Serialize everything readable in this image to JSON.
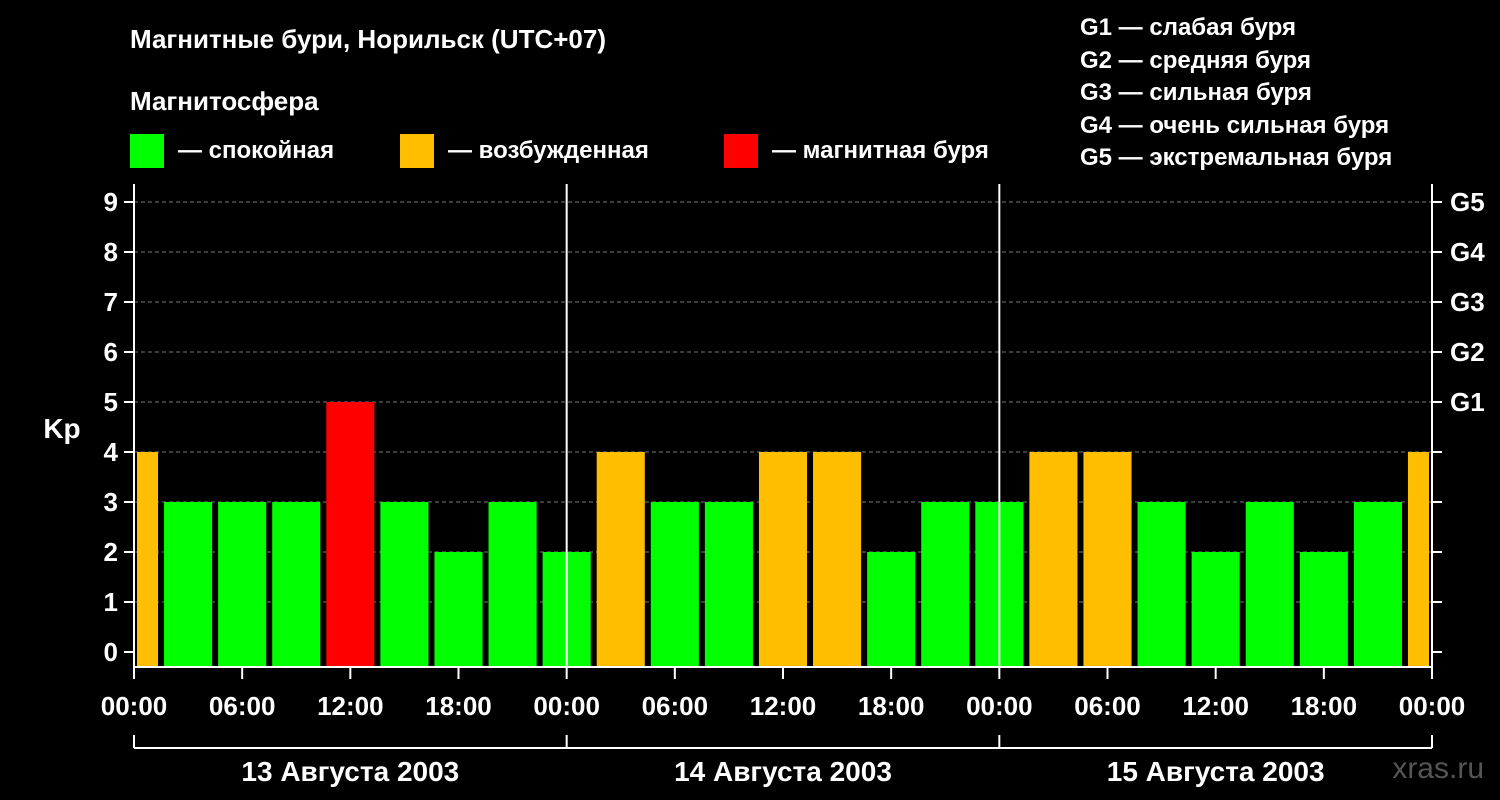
{
  "chart_data": {
    "type": "bar",
    "title": "Магнитные бури, Норильск (UTC+07)",
    "subtitle": "Магнитосфера",
    "ylabel": "Kp",
    "ylim": [
      0,
      9
    ],
    "yticks": [
      "0",
      "1",
      "2",
      "3",
      "4",
      "5",
      "6",
      "7",
      "8",
      "9"
    ],
    "right_ticks": [
      {
        "value": 5,
        "label": "G1"
      },
      {
        "value": 6,
        "label": "G2"
      },
      {
        "value": 7,
        "label": "G3"
      },
      {
        "value": 8,
        "label": "G4"
      },
      {
        "value": 9,
        "label": "G5"
      }
    ],
    "x_range_hours": [
      0,
      72
    ],
    "xtick_labels": [
      "00:00",
      "06:00",
      "12:00",
      "18:00",
      "00:00",
      "06:00",
      "12:00",
      "18:00",
      "00:00",
      "06:00",
      "12:00",
      "18:00",
      "00:00"
    ],
    "day_labels": [
      "13 Августа 2003",
      "14 Августа 2003",
      "15 Августа 2003"
    ],
    "status_colors": {
      "calm": "#00ff00",
      "excited": "#ffbf00",
      "storm": "#ff0000"
    },
    "legend": [
      {
        "status": "calm",
        "label": "— спокойная"
      },
      {
        "status": "excited",
        "label": "— возбужденная"
      },
      {
        "status": "storm",
        "label": "— магнитная буря"
      }
    ],
    "storm_scale": [
      "G1 — слабая буря",
      "G2 — средняя буря",
      "G3 — сильная буря",
      "G4 — очень сильная буря",
      "G5 — экстремальная буря"
    ],
    "bars": [
      {
        "start": -1.5,
        "end": 1.5,
        "kp": 4,
        "status": "excited"
      },
      {
        "start": 1.5,
        "end": 4.5,
        "kp": 3,
        "status": "calm"
      },
      {
        "start": 4.5,
        "end": 7.5,
        "kp": 3,
        "status": "calm"
      },
      {
        "start": 7.5,
        "end": 10.5,
        "kp": 3,
        "status": "calm"
      },
      {
        "start": 10.5,
        "end": 13.5,
        "kp": 5,
        "status": "storm"
      },
      {
        "start": 13.5,
        "end": 16.5,
        "kp": 3,
        "status": "calm"
      },
      {
        "start": 16.5,
        "end": 19.5,
        "kp": 2,
        "status": "calm"
      },
      {
        "start": 19.5,
        "end": 22.5,
        "kp": 3,
        "status": "calm"
      },
      {
        "start": 22.5,
        "end": 25.5,
        "kp": 2,
        "status": "calm"
      },
      {
        "start": 25.5,
        "end": 28.5,
        "kp": 4,
        "status": "excited"
      },
      {
        "start": 28.5,
        "end": 31.5,
        "kp": 3,
        "status": "calm"
      },
      {
        "start": 31.5,
        "end": 34.5,
        "kp": 3,
        "status": "calm"
      },
      {
        "start": 34.5,
        "end": 37.5,
        "kp": 4,
        "status": "excited"
      },
      {
        "start": 37.5,
        "end": 40.5,
        "kp": 4,
        "status": "excited"
      },
      {
        "start": 40.5,
        "end": 43.5,
        "kp": 2,
        "status": "calm"
      },
      {
        "start": 43.5,
        "end": 46.5,
        "kp": 3,
        "status": "calm"
      },
      {
        "start": 46.5,
        "end": 49.5,
        "kp": 3,
        "status": "calm"
      },
      {
        "start": 49.5,
        "end": 52.5,
        "kp": 4,
        "status": "excited"
      },
      {
        "start": 52.5,
        "end": 55.5,
        "kp": 4,
        "status": "excited"
      },
      {
        "start": 55.5,
        "end": 58.5,
        "kp": 3,
        "status": "calm"
      },
      {
        "start": 58.5,
        "end": 61.5,
        "kp": 2,
        "status": "calm"
      },
      {
        "start": 61.5,
        "end": 64.5,
        "kp": 3,
        "status": "calm"
      },
      {
        "start": 64.5,
        "end": 67.5,
        "kp": 2,
        "status": "calm"
      },
      {
        "start": 67.5,
        "end": 70.5,
        "kp": 3,
        "status": "calm"
      },
      {
        "start": 70.5,
        "end": 73.5,
        "kp": 4,
        "status": "excited"
      }
    ],
    "grid": true,
    "watermark": "xras.ru"
  }
}
